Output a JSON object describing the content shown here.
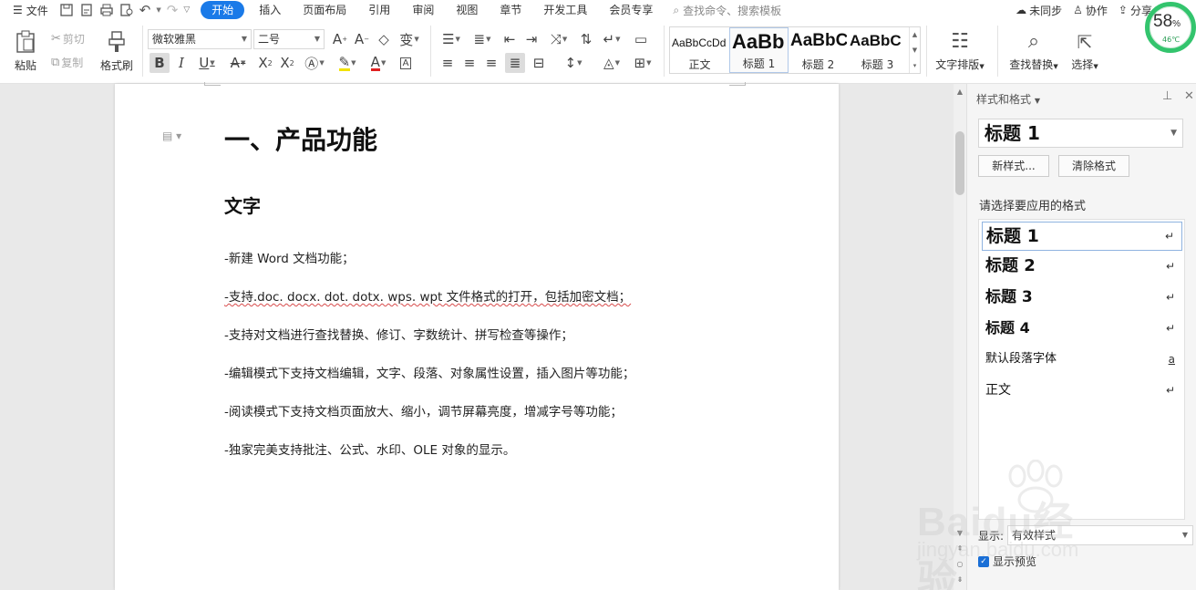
{
  "menubar": {
    "file_label": "文件",
    "tabs": [
      "开始",
      "插入",
      "页面布局",
      "引用",
      "审阅",
      "视图",
      "章节",
      "开发工具",
      "会员专享"
    ],
    "search_placeholder": "查找命令、搜索模板",
    "sync_label": "未同步",
    "collab_label": "协作",
    "share_label": "分享"
  },
  "gauge": {
    "percent": "58",
    "percent_sign": "%",
    "temp": "46℃"
  },
  "ribbon": {
    "paste_label": "粘贴",
    "cut_label": "剪切",
    "copy_label": "复制",
    "format_painter_label": "格式刷",
    "font_name": "微软雅黑",
    "font_size": "二号",
    "text_layout_label": "文字排版",
    "find_replace_label": "查找替换",
    "select_label": "选择",
    "styles": [
      {
        "preview": "AaBbCcDd",
        "name": "正文"
      },
      {
        "preview": "AaBb",
        "name": "标题 1"
      },
      {
        "preview": "AaBbC",
        "name": "标题 2"
      },
      {
        "preview": "AaBbC",
        "name": "标题 3"
      }
    ]
  },
  "document": {
    "heading1": "一、产品功能",
    "heading2": "文字",
    "paragraphs": [
      "-新建 Word 文档功能；",
      "-支持.doc. docx. dot. dotx. wps. wpt  文件格式的打开，包括加密文档；",
      "-支持对文档进行查找替换、修订、字数统计、拼写检查等操作；",
      "-编辑模式下支持文档编辑，文字、段落、对象属性设置，插入图片等功能；",
      "-阅读模式下支持文档页面放大、缩小，调节屏幕亮度，增减字号等功能；",
      "-独家完美支持批注、公式、水印、OLE 对象的显示。"
    ]
  },
  "pane": {
    "title": "样式和格式",
    "current_style": "标题  1",
    "new_style_label": "新样式...",
    "clear_format_label": "清除格式",
    "choose_label": "请选择要应用的格式",
    "styles": [
      {
        "name": "标题  1",
        "mark": "↵"
      },
      {
        "name": "标题  2",
        "mark": "↵"
      },
      {
        "name": "标题  3",
        "mark": "↵"
      },
      {
        "name": "标题  4",
        "mark": "↵"
      },
      {
        "name": "默认段落字体",
        "mark": "a"
      },
      {
        "name": "正文",
        "mark": "↵"
      }
    ],
    "show_label": "显示:",
    "show_value": "有效样式",
    "preview_label": "显示预览"
  },
  "watermark": {
    "brand": "Baidu经验",
    "url": "jingyan.baidu.com"
  }
}
